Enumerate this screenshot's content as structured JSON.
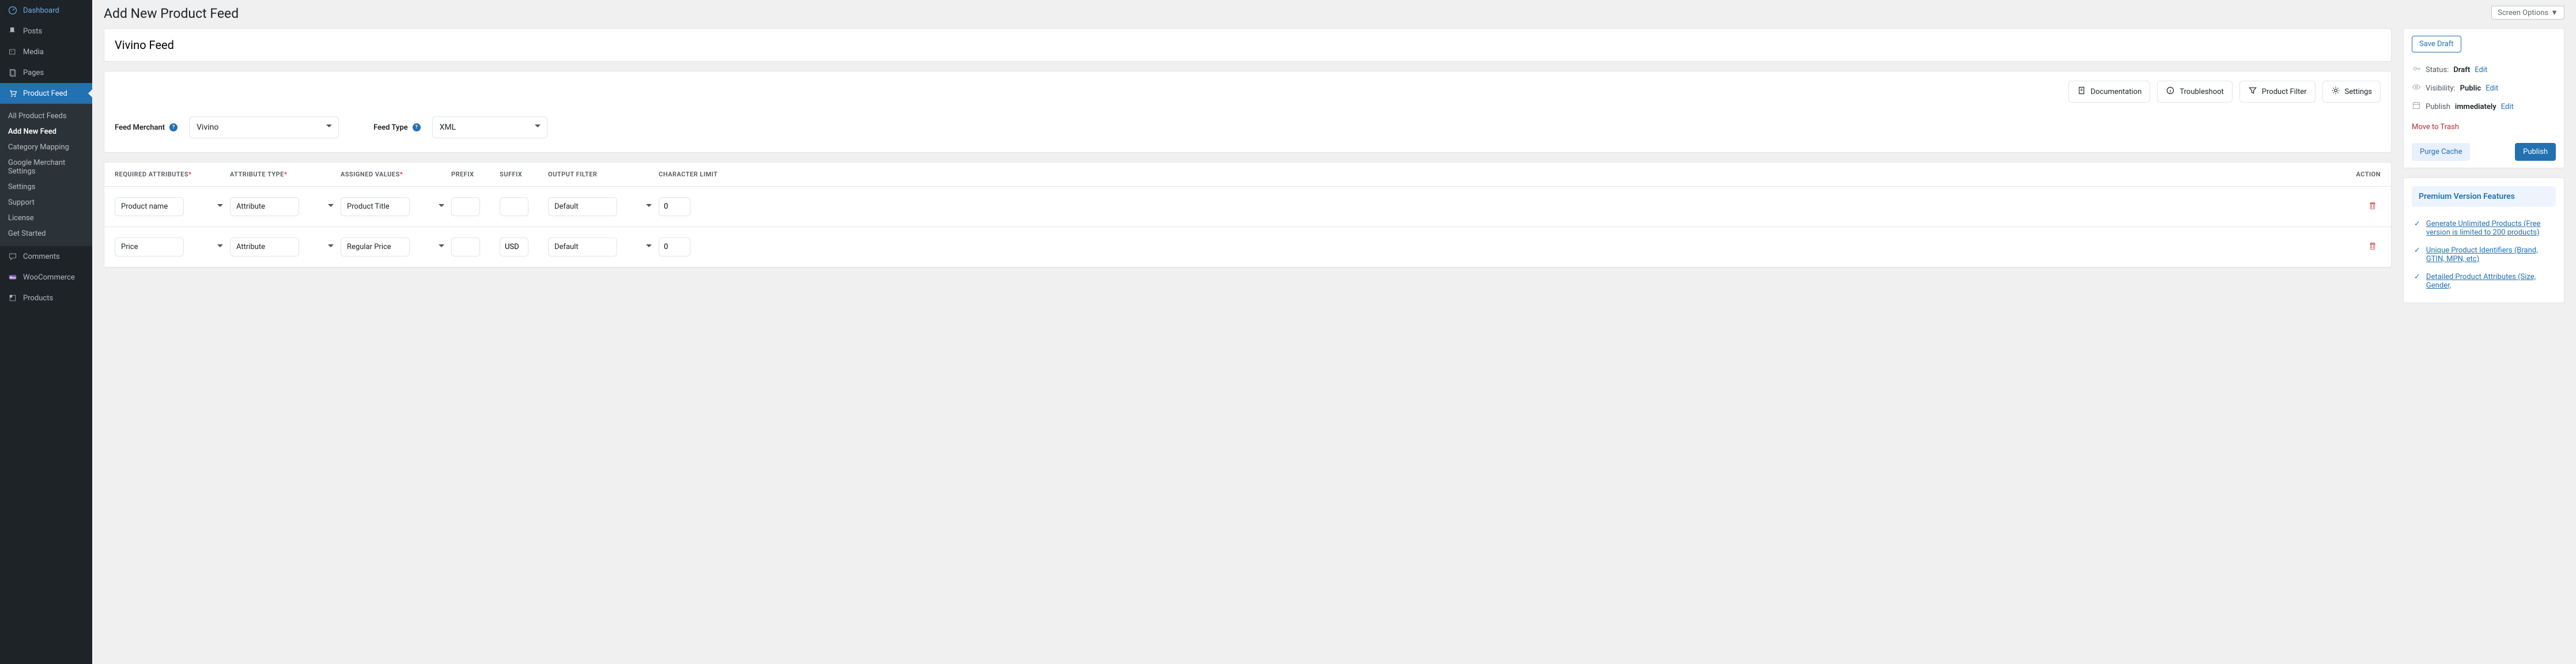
{
  "header": {
    "page_title": "Add New Product Feed",
    "screen_options": "Screen Options"
  },
  "adminmenu": {
    "dashboard": "Dashboard",
    "posts": "Posts",
    "media": "Media",
    "pages": "Pages",
    "product_feed": "Product Feed",
    "comments": "Comments",
    "woocommerce": "WooCommerce",
    "products": "Products"
  },
  "submenu": {
    "all_feeds": "All Product Feeds",
    "add_new": "Add New Feed",
    "category_mapping": "Category Mapping",
    "google_merchant": "Google Merchant Settings",
    "settings": "Settings",
    "support": "Support",
    "license": "License",
    "get_started": "Get Started"
  },
  "feed": {
    "title": "Vivino Feed",
    "merchant_label": "Feed Merchant",
    "merchant_value": "Vivino",
    "type_label": "Feed Type",
    "type_value": "XML"
  },
  "toolbar": {
    "documentation": "Documentation",
    "troubleshoot": "Troubleshoot",
    "product_filter": "Product Filter",
    "settings": "Settings"
  },
  "table": {
    "h_required": "REQUIRED ATTRIBUTES",
    "h_type": "ATTRIBUTE TYPE",
    "h_assigned": "ASSIGNED VALUES",
    "h_prefix": "PREFIX",
    "h_suffix": "SUFFIX",
    "h_filter": "OUTPUT FILTER",
    "h_limit": "CHARACTER LIMIT",
    "h_action": "ACTION",
    "rows": [
      {
        "req": "Product name",
        "type": "Attribute",
        "assigned": "Product Title",
        "prefix": "",
        "suffix": "",
        "filter": "Default",
        "limit": "0"
      },
      {
        "req": "Price",
        "type": "Attribute",
        "assigned": "Regular Price",
        "prefix": "",
        "suffix": "USD",
        "filter": "Default",
        "limit": "0"
      }
    ]
  },
  "publish": {
    "save_draft": "Save Draft",
    "status_label": "Status:",
    "status_value": "Draft",
    "visibility_label": "Visibility:",
    "visibility_value": "Public",
    "publish_label": "Publish",
    "publish_value": "immediately",
    "edit": "Edit",
    "move_to_trash": "Move to Trash",
    "purge_cache": "Purge Cache",
    "publish_btn": "Publish"
  },
  "premium": {
    "title": "Premium Version Features",
    "items": [
      "Generate Unlimited Products (Free version is limited to 200 products)",
      "Unique Product Identifiers (Brand, GTIN, MPN, etc)",
      "Detailed Product Attributes (Size, Gender,"
    ]
  }
}
